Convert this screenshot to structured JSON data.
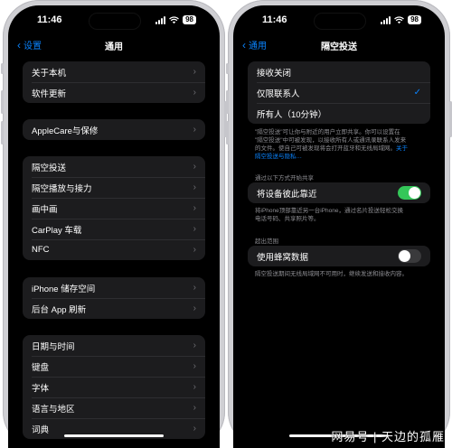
{
  "status": {
    "time": "11:46",
    "battery": "98"
  },
  "left": {
    "back": "设置",
    "title": "通用",
    "groups": [
      [
        "关于本机",
        "软件更新"
      ],
      [
        "AppleCare与保修"
      ],
      [
        "隔空投送",
        "隔空播放与接力",
        "画中画",
        "CarPlay 车载",
        "NFC"
      ],
      [
        "iPhone 储存空间",
        "后台 App 刷新"
      ],
      [
        "日期与时间",
        "键盘",
        "字体",
        "语言与地区",
        "词典"
      ]
    ]
  },
  "right": {
    "back": "通用",
    "title": "隔空投送",
    "options": [
      "接收关闭",
      "仅限联系人",
      "所有人（10分钟）"
    ],
    "selected_index": 1,
    "caption1_lines": [
      "\"隔空投送\"可让你与附近的用户立即共享。你可以设置在",
      "\"隔空投送\"中可被发现，以接收所有人或通讯录联系人发来",
      "的文件。使自己可被发现将会打开蓝牙和无线局域网。"
    ],
    "caption1_link": "关于",
    "caption1_link2": "隔空投送与隐私…",
    "section_share": "通过以下方式开始共享",
    "proximity_label": "将设备彼此靠近",
    "proximity_on": true,
    "caption2_lines": [
      "将iPhone顶部靠近另一台iPhone，通过名片投送轻松交换",
      "电话号码、共享照片等。"
    ],
    "section_range": "超出范围",
    "cellular_label": "使用蜂窝数据",
    "cellular_on": false,
    "caption3": "隔空投送期间无线局域网不可用时，继续发送和接收内容。"
  },
  "watermark": "网易号 | 天边的孤雁"
}
